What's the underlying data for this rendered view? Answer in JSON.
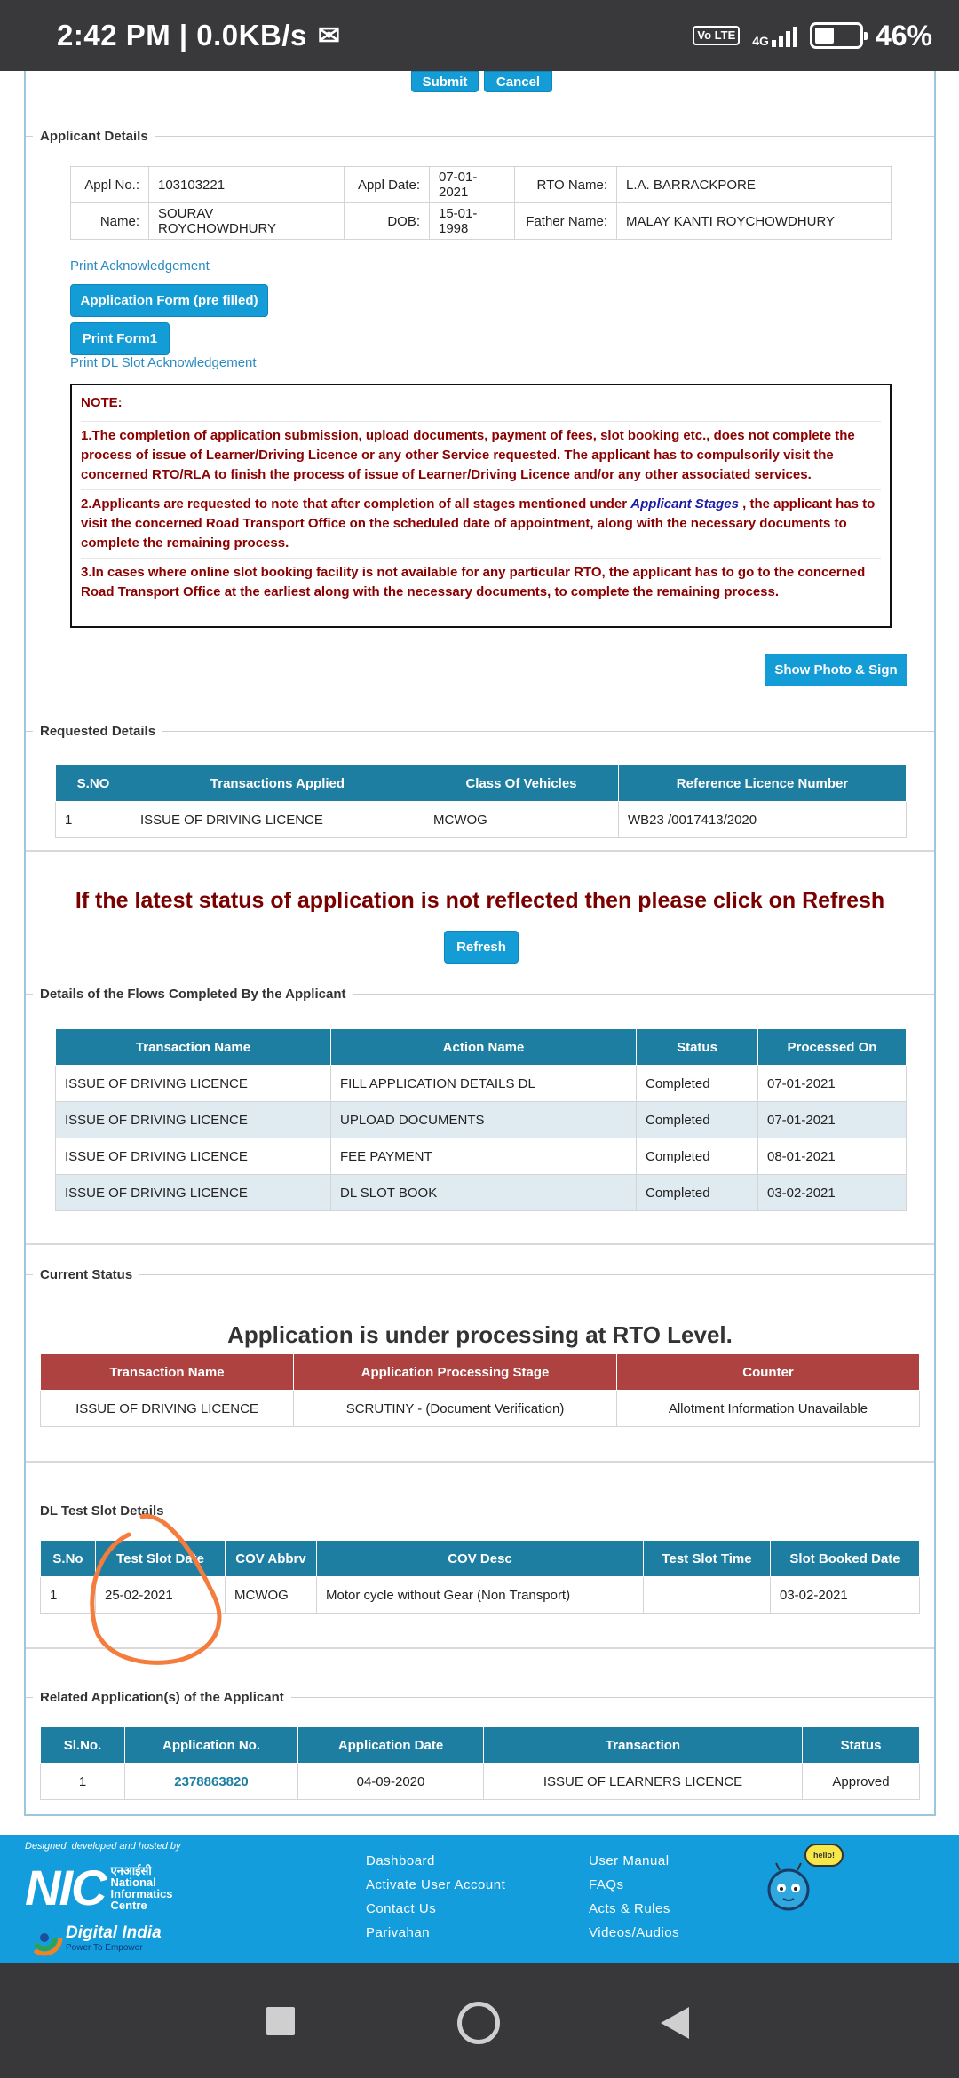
{
  "status_bar": {
    "time": "2:42 PM | 0.0KB/s",
    "volte": "Vo LTE",
    "network": "4G",
    "battery": "46%"
  },
  "top_actions": {
    "submit": "Submit",
    "cancel": "Cancel"
  },
  "applicant": {
    "legend": "Applicant Details",
    "appl_no_label": "Appl No.:",
    "appl_no": "103103221",
    "appl_date_label": "Appl Date:",
    "appl_date": "07-01-2021",
    "rto_label": "RTO Name:",
    "rto": "L.A. BARRACKPORE",
    "name_label": "Name:",
    "name": "SOURAV ROYCHOWDHURY",
    "dob_label": "DOB:",
    "dob": "15-01-1998",
    "father_label": "Father  Name:",
    "father": "MALAY KANTI ROYCHOWDHURY"
  },
  "links": {
    "print_ack": "Print Acknowledgement",
    "app_form": "Application Form (pre filled)",
    "print_form1": "Print Form1",
    "print_dl_slot": "Print DL Slot Acknowledgement"
  },
  "note": {
    "title": "NOTE:",
    "p1": "1.The completion of application submission, upload documents, payment of fees, slot booking etc., does not complete the process of issue of Learner/Driving Licence or any other Service requested. The applicant has to compulsorily visit the concerned RTO/RLA to finish the process of issue of Learner/Driving Licence and/or any other associated services.",
    "p2_a": "2.Applicants are requested to note that after completion of all stages mentioned under ",
    "p2_link": "Applicant Stages",
    "p2_b": " , the applicant has to visit the concerned Road Transport Office on the scheduled date of appointment, along with the necessary documents to complete the remaining process.",
    "p3": "3.In cases where online slot booking facility is not available for any particular RTO, the applicant has to go to the concerned Road Transport Office at the earliest along with the necessary documents, to complete the remaining process."
  },
  "show_photo": "Show Photo & Sign",
  "requested": {
    "legend": "Requested Details",
    "headers": [
      "S.NO",
      "Transactions Applied",
      "Class Of Vehicles",
      "Reference Licence Number"
    ],
    "row": [
      "1",
      "ISSUE OF DRIVING LICENCE",
      "MCWOG",
      "WB23 /0017413/2020"
    ]
  },
  "refresh_msg": "If the latest status of application is not reflected then please click on Refresh",
  "refresh_btn": "Refresh",
  "flows": {
    "legend": "Details of the Flows Completed By the Applicant",
    "headers": [
      "Transaction Name",
      "Action Name",
      "Status",
      "Processed On"
    ],
    "rows": [
      [
        "ISSUE OF DRIVING LICENCE",
        "FILL APPLICATION DETAILS DL",
        "Completed",
        "07-01-2021"
      ],
      [
        "ISSUE OF DRIVING LICENCE",
        "UPLOAD DOCUMENTS",
        "Completed",
        "07-01-2021"
      ],
      [
        "ISSUE OF DRIVING LICENCE",
        "FEE PAYMENT",
        "Completed",
        "08-01-2021"
      ],
      [
        "ISSUE OF DRIVING LICENCE",
        "DL SLOT BOOK",
        "Completed",
        "03-02-2021"
      ]
    ]
  },
  "current": {
    "legend": "Current Status",
    "headline": "Application is under processing at RTO Level.",
    "headers": [
      "Transaction Name",
      "Application Processing Stage",
      "Counter"
    ],
    "row": [
      "ISSUE OF DRIVING LICENCE",
      "SCRUTINY - (Document Verification)",
      "Allotment Information Unavailable"
    ]
  },
  "slot": {
    "legend": "DL Test Slot Details",
    "headers": [
      "S.No",
      "Test Slot Date",
      "COV Abbrv",
      "COV Desc",
      "Test Slot Time",
      "Slot Booked Date"
    ],
    "row": [
      "1",
      "25-02-2021",
      "MCWOG",
      "Motor cycle without Gear (Non Transport)",
      "",
      "03-02-2021"
    ]
  },
  "related": {
    "legend": "Related Application(s) of the Applicant",
    "headers": [
      "Sl.No.",
      "Application No.",
      "Application Date",
      "Transaction",
      "Status"
    ],
    "row": [
      "1",
      "2378863820",
      "04-09-2020",
      "ISSUE OF LEARNERS LICENCE",
      "Approved"
    ]
  },
  "footer": {
    "designed_by": "Designed, developed and hosted by",
    "nic_hindi": "एनआईसी",
    "nic_l1": "National",
    "nic_l2": "Informatics",
    "nic_l3": "Centre",
    "digital_india": "Digital India",
    "digital_tag": "Power To Empower",
    "col1": [
      "Dashboard",
      "Activate User Account",
      "Contact Us",
      "Parivahan"
    ],
    "col2": [
      "User Manual",
      "FAQs",
      "Acts & Rules",
      "Videos/Audios"
    ],
    "hello": "hello!"
  }
}
